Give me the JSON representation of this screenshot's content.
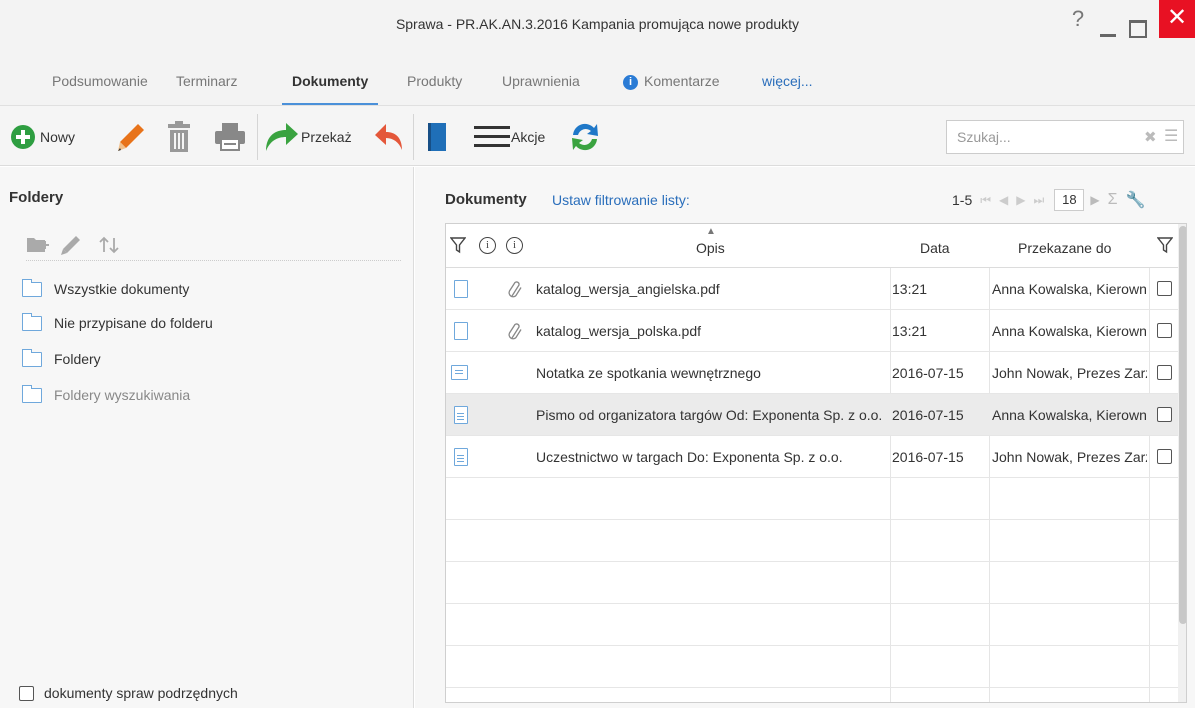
{
  "window": {
    "title": "Sprawa - PR.AK.AN.3.2016 Kampania promująca nowe produkty",
    "help": "?",
    "close": "✕"
  },
  "tabs": [
    {
      "label": "Podsumowanie"
    },
    {
      "label": "Terminarz"
    },
    {
      "label": "Dokumenty",
      "active": true
    },
    {
      "label": "Produkty"
    },
    {
      "label": "Uprawnienia"
    },
    {
      "label": "Komentarze",
      "icon": "info-icon"
    },
    {
      "label": "więcej..."
    }
  ],
  "toolbar": {
    "new_label": "Nowy",
    "forward_label": "Przekaż",
    "actions_label": "Akcje",
    "search_placeholder": "Szukaj...",
    "icons": [
      "add-circle-icon",
      "pencil-icon",
      "trash-icon",
      "printer-icon",
      "forward-arrow-icon",
      "reply-arrow-icon",
      "book-icon",
      "hamburger-icon",
      "refresh-icon"
    ]
  },
  "colors": {
    "accent": "#2a6ebb",
    "new_green": "#2e9e41",
    "edit_orange": "#e8731a",
    "forward_green": "#3aa340",
    "reply_red": "#e4573a",
    "book_blue": "#1f6fb8",
    "close_red": "#e81123"
  },
  "folders_panel": {
    "title": "Foldery",
    "tools": [
      "add-folder-icon",
      "pencil-icon",
      "refresh-folder-icon"
    ],
    "items": [
      {
        "label": "Wszystkie dokumenty"
      },
      {
        "label": "Nie przypisane do folderu"
      },
      {
        "label": "Foldery"
      },
      {
        "label": "Foldery wyszukiwania",
        "muted": true
      }
    ],
    "subcases_label": "dokumenty spraw podrzędnych"
  },
  "documents_panel": {
    "title": "Dokumenty",
    "filter_link": "Ustaw filtrowanie listy:",
    "range": "1-5",
    "page_size": "18",
    "columns": {
      "desc": "Opis",
      "date": "Data",
      "to": "Przekazane do"
    },
    "rows": [
      {
        "type": "file",
        "attachment": true,
        "desc": "katalog_wersja_angielska.pdf",
        "date": "13:21",
        "to": "Anna Kowalska, Kierownik"
      },
      {
        "type": "file",
        "attachment": true,
        "desc": "katalog_wersja_polska.pdf",
        "date": "13:21",
        "to": "Anna Kowalska, Kierownik"
      },
      {
        "type": "note",
        "attachment": false,
        "desc": "Notatka ze spotkania wewnętrznego",
        "date": "2016-07-15",
        "to": "John Nowak, Prezes Zarządu"
      },
      {
        "type": "letter",
        "attachment": false,
        "desc": "Pismo od organizatora targów Od: Exponenta Sp. z o.o.",
        "date": "2016-07-15",
        "to": "Anna Kowalska, Kierownik",
        "selected": true
      },
      {
        "type": "letter",
        "attachment": false,
        "desc": "Uczestnictwo w targach Do: Exponenta Sp. z o.o.",
        "date": "2016-07-15",
        "to": "John Nowak, Prezes Zarządu"
      }
    ]
  }
}
